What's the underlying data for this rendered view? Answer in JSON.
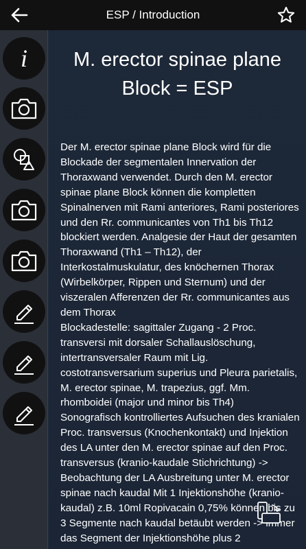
{
  "appbar": {
    "title": "ESP / Introduction",
    "back_icon": "arrow-left-icon",
    "favorite_icon": "star-outline-icon"
  },
  "sidebar": {
    "items": [
      {
        "icon": "info-icon",
        "label": "i"
      },
      {
        "icon": "camera-icon"
      },
      {
        "icon": "shapes-icon"
      },
      {
        "icon": "camera-icon"
      },
      {
        "icon": "camera-icon"
      },
      {
        "icon": "pencil-icon"
      },
      {
        "icon": "pencil-icon"
      },
      {
        "icon": "pencil-icon"
      }
    ]
  },
  "main": {
    "title": "M. erector spinae plane Block = ESP",
    "body": "Der M. erector spinae plane Block wird für die Blockade der segmentalen Innervation der Thoraxwand verwendet. Durch den M. erector spinae plane Block können die kompletten Spinalnerven mit Rami anteriores, Rami posteriores und den Rr. communicantes von Th1 bis Th12 blockiert werden. Analgesie der Haut der gesamten Thoraxwand (Th1 – Th12), der Interkostalmuskulatur, des knöchernen Thorax (Wirbelkörper, Rippen und Sternum) und der viszeralen Afferenzen der Rr. communicantes aus dem Thorax\nBlockadestelle: sagittaler Zugang - 2 Proc. transversi mit dorsaler Schallauslöschung, intertransversaler Raum mit Lig. costotransversarium superius und Pleura parietalis, M. erector spinae, M. trapezius, ggf. Mm. rhomboidei (major und minor bis Th4)\nSonografisch kontrolliertes Aufsuchen des kranialen Proc. transversus (Knochenkontakt) und Injektion des LA unter den M. erector spinae auf den Proc. transversus (kranio-kaudale Stichrichtung) -> Beobachtung der LA Ausbreitung unter M. erector spinae nach kaudal Mit 1 Injektionshöhe (kranio-kaudal) z.B. 10ml Ropivacain 0,75% können bis zu 3 Segmente nach kaudal betäubt werden -> immer das Segment der Injektionshöhe plus 2"
  },
  "floating": {
    "icon": "screen-rotate-icon"
  },
  "colors": {
    "appbar": "#111111",
    "sidebar": "#2a2f38",
    "content_bg": "#1d2838",
    "text": "#ffffff"
  }
}
